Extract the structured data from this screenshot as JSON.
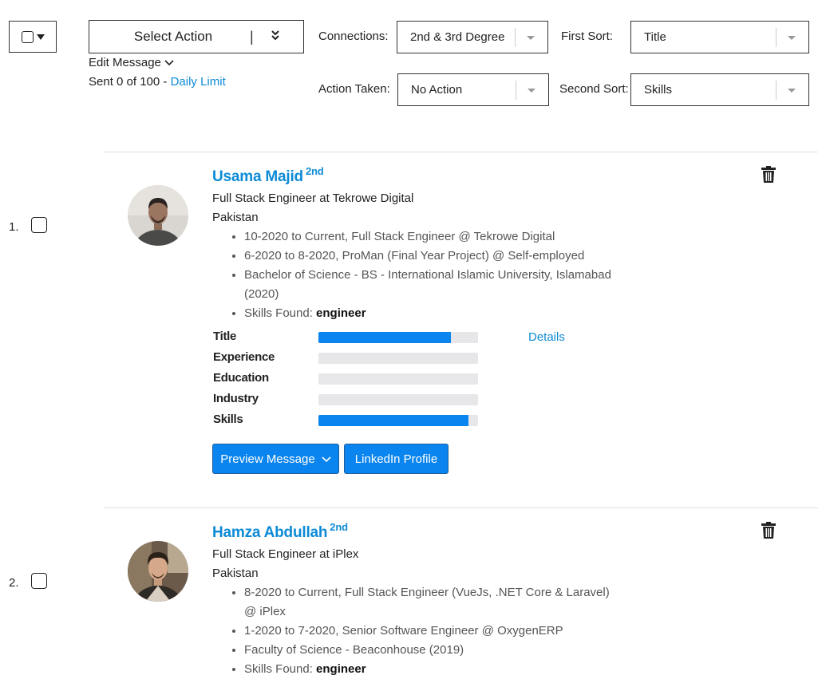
{
  "toolbar": {
    "select_action_label": "Select Action",
    "select_action_separator": "|",
    "edit_message_label": "Edit Message",
    "sent_text": "Sent 0 of 100 -",
    "daily_limit_link": "Daily Limit",
    "connections_label": "Connections:",
    "connections_value": "2nd & 3rd Degree",
    "first_sort_label": "First Sort:",
    "first_sort_value": "Title",
    "action_taken_label": "Action Taken:",
    "action_taken_value": "No Action",
    "second_sort_label": "Second Sort:",
    "second_sort_value": "Skills"
  },
  "candidates": [
    {
      "index": "1.",
      "name": "Usama Majid",
      "degree": "2nd",
      "headline": "Full Stack Engineer at Tekrowe Digital",
      "location": "Pakistan",
      "bullets": [
        "10-2020 to Current, Full Stack Engineer @ Tekrowe Digital",
        "6-2020 to 8-2020, ProMan (Final Year Project) @ Self-employed",
        "Bachelor of Science - BS - International Islamic University, Islamabad (2020)"
      ],
      "skills_label": "Skills Found:",
      "skills_value": "engineer",
      "scores": [
        {
          "label": "Title",
          "value": 0.83
        },
        {
          "label": "Experience",
          "value": 0
        },
        {
          "label": "Education",
          "value": 0
        },
        {
          "label": "Industry",
          "value": 0
        },
        {
          "label": "Skills",
          "value": 0.94
        }
      ],
      "details_link": "Details",
      "preview_button": "Preview Message",
      "linkedin_button": "LinkedIn Profile"
    },
    {
      "index": "2.",
      "name": "Hamza Abdullah",
      "degree": "2nd",
      "headline": "Full Stack Engineer at iPlex",
      "location": "Pakistan",
      "bullets": [
        "8-2020 to Current, Full Stack Engineer (VueJs, .NET Core & Laravel) @ iPlex",
        "1-2020 to 7-2020, Senior Software Engineer @ OxygenERP",
        "Faculty of Science - Beaconhouse (2019)"
      ],
      "skills_label": "Skills Found:",
      "skills_value": "engineer"
    }
  ],
  "colors": {
    "link": "#0d8bd6",
    "button": "#0a84ee",
    "bar_empty": "#e7e7ea"
  }
}
